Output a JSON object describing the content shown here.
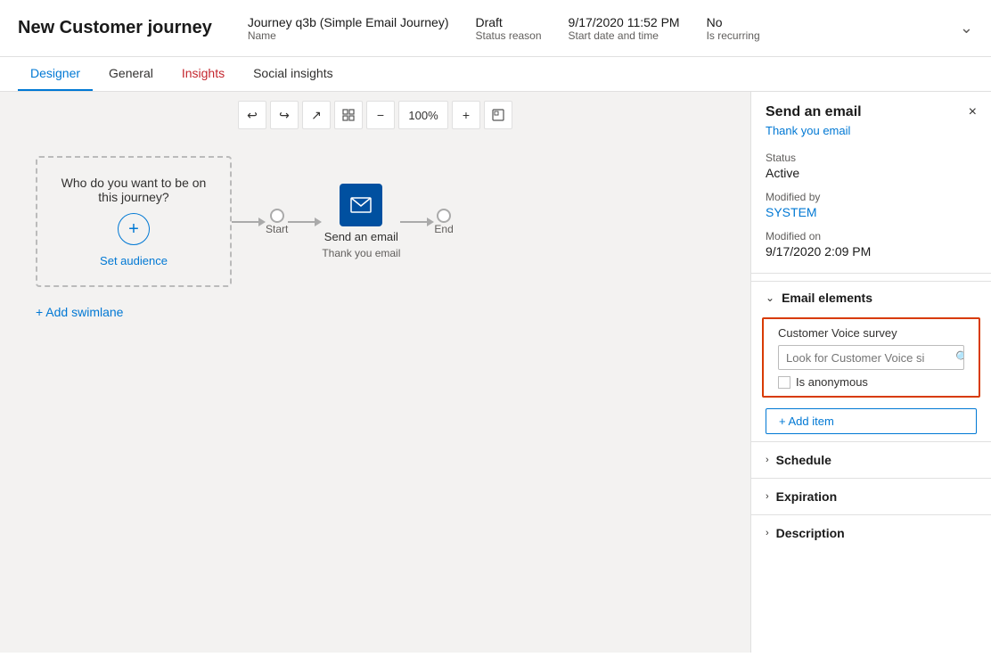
{
  "header": {
    "title": "New Customer journey",
    "journey_name": "Journey q3b (Simple Email Journey)",
    "journey_name_label": "Name",
    "status": "Draft",
    "status_label": "Status reason",
    "start_date": "9/17/2020 11:52 PM",
    "start_date_label": "Start date and time",
    "is_recurring": "No",
    "is_recurring_label": "Is recurring"
  },
  "tabs": [
    {
      "id": "designer",
      "label": "Designer",
      "active": true
    },
    {
      "id": "general",
      "label": "General",
      "active": false
    },
    {
      "id": "insights",
      "label": "Insights",
      "active": false,
      "highlighted": true
    },
    {
      "id": "social_insights",
      "label": "Social insights",
      "active": false
    }
  ],
  "toolbar": {
    "undo": "↩",
    "redo": "↪",
    "expand": "↗",
    "fit": "⊞",
    "zoom_out": "−",
    "zoom_level": "100%",
    "zoom_in": "+",
    "fullscreen": "⊡"
  },
  "canvas": {
    "audience_title": "Who do you want to be on this journey?",
    "set_audience_label": "Set audience",
    "start_label": "Start",
    "end_label": "End",
    "email_node_title": "Send an email",
    "email_node_sub": "Thank you email",
    "add_swimlane_label": "+ Add swimlane"
  },
  "right_panel": {
    "title": "Send an email",
    "subtitle": "Thank you email",
    "close_icon": "×",
    "status_label": "Status",
    "status_value": "Active",
    "modified_by_label": "Modified by",
    "modified_by_value": "SYSTEM",
    "modified_on_label": "Modified on",
    "modified_on_value": "9/17/2020 2:09 PM",
    "email_elements_label": "Email elements",
    "cv_survey_label": "Customer Voice survey",
    "cv_search_placeholder": "Look for Customer Voice si",
    "cv_anonymous_label": "Is anonymous",
    "add_item_label": "+ Add item",
    "schedule_label": "Schedule",
    "expiration_label": "Expiration",
    "description_label": "Description"
  }
}
